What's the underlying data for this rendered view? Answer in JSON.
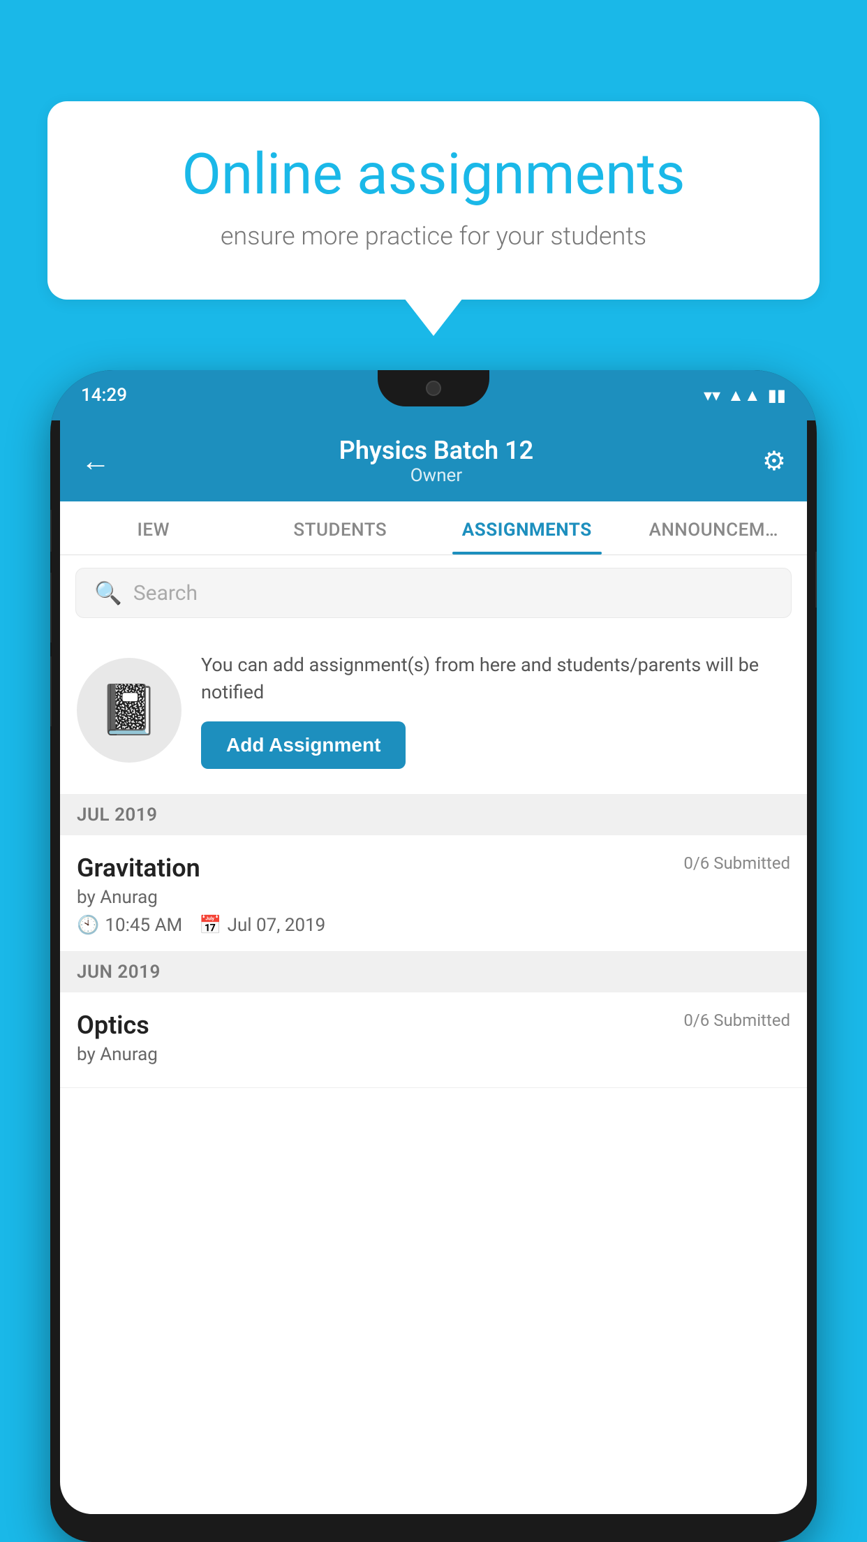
{
  "background_color": "#1ab8e8",
  "speech_bubble": {
    "title": "Online assignments",
    "subtitle": "ensure more practice for your students"
  },
  "phone": {
    "status_bar": {
      "time": "14:29",
      "wifi": "▲",
      "signal": "▲",
      "battery": "▮"
    },
    "header": {
      "title": "Physics Batch 12",
      "subtitle": "Owner",
      "back_label": "←",
      "settings_label": "⚙"
    },
    "tabs": [
      {
        "label": "IEW",
        "active": false
      },
      {
        "label": "STUDENTS",
        "active": false
      },
      {
        "label": "ASSIGNMENTS",
        "active": true
      },
      {
        "label": "ANNOUNCEM…",
        "active": false
      }
    ],
    "search": {
      "placeholder": "Search"
    },
    "promo": {
      "description": "You can add assignment(s) from here and students/parents will be notified",
      "button_label": "Add Assignment"
    },
    "sections": [
      {
        "month_label": "JUL 2019",
        "assignments": [
          {
            "name": "Gravitation",
            "submitted": "0/6 Submitted",
            "by": "by Anurag",
            "time": "10:45 AM",
            "date": "Jul 07, 2019"
          }
        ]
      },
      {
        "month_label": "JUN 2019",
        "assignments": [
          {
            "name": "Optics",
            "submitted": "0/6 Submitted",
            "by": "by Anurag",
            "time": "",
            "date": ""
          }
        ]
      }
    ]
  }
}
